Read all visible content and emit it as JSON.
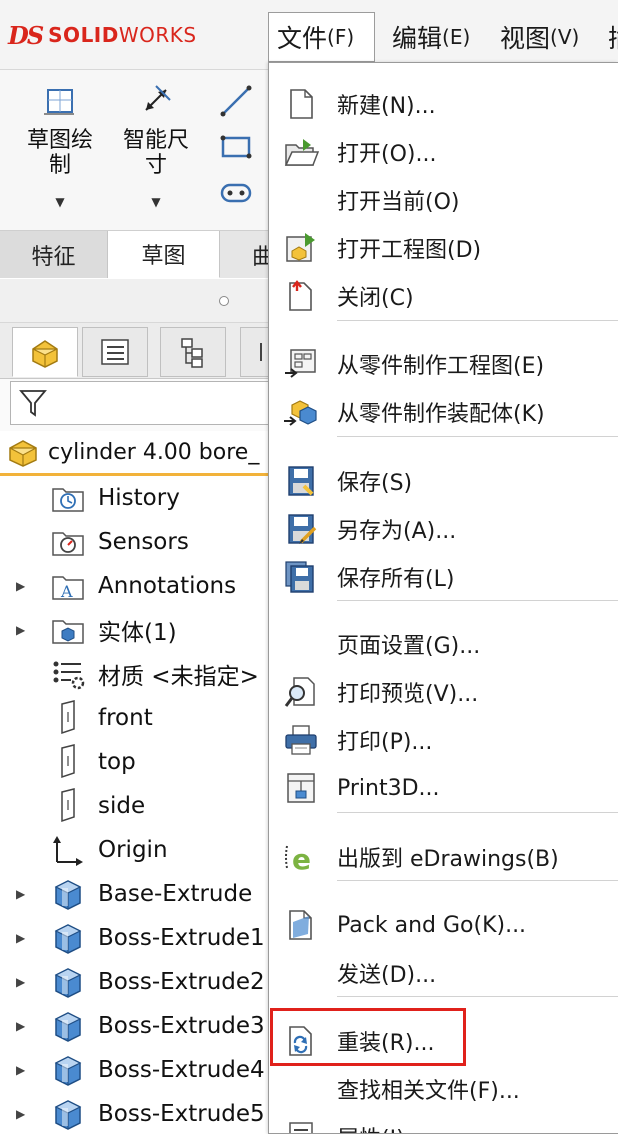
{
  "app": {
    "logo_mark": "DS",
    "logo_text_bold": "SOLID",
    "logo_text_light": "WORKS",
    "brand_color": "#d9261c"
  },
  "menubar": {
    "file": {
      "label": "文件",
      "accel": "(F)"
    },
    "edit": {
      "label": "编辑",
      "accel": "(E)"
    },
    "view": {
      "label": "视图",
      "accel": "(V)"
    },
    "more": {
      "label": "插"
    }
  },
  "command_manager": {
    "sketch": {
      "label_line1": "草图绘",
      "label_line2": "制",
      "icon": "sketch-icon"
    },
    "smart_dimension": {
      "label_line1": "智能尺",
      "label_line2": "寸",
      "icon": "smart-dimension-icon"
    },
    "tools": [
      "line-icon",
      "rectangle-icon",
      "slot-icon"
    ]
  },
  "tabs": {
    "feature": "特征",
    "sketch": "草图",
    "surface": "曲"
  },
  "feature_tree": {
    "root": "cylinder 4.00 bore_",
    "items": [
      {
        "label": "History",
        "icon": "history-folder-icon",
        "expandable": false
      },
      {
        "label": "Sensors",
        "icon": "sensors-folder-icon",
        "expandable": false
      },
      {
        "label": "Annotations",
        "icon": "annotations-folder-icon",
        "expandable": true
      },
      {
        "label": "实体(1)",
        "icon": "solid-bodies-folder-icon",
        "expandable": true
      },
      {
        "label": "材质 <未指定>",
        "icon": "material-icon",
        "expandable": false
      },
      {
        "label": "front",
        "icon": "plane-icon",
        "expandable": false
      },
      {
        "label": "top",
        "icon": "plane-icon",
        "expandable": false
      },
      {
        "label": "side",
        "icon": "plane-icon",
        "expandable": false
      },
      {
        "label": "Origin",
        "icon": "origin-icon",
        "expandable": false
      },
      {
        "label": "Base-Extrude",
        "icon": "extrude-icon",
        "expandable": true
      },
      {
        "label": "Boss-Extrude1",
        "icon": "extrude-icon",
        "expandable": true
      },
      {
        "label": "Boss-Extrude2",
        "icon": "extrude-icon",
        "expandable": true
      },
      {
        "label": "Boss-Extrude3",
        "icon": "extrude-icon",
        "expandable": true
      },
      {
        "label": "Boss-Extrude4",
        "icon": "extrude-icon",
        "expandable": true
      },
      {
        "label": "Boss-Extrude5",
        "icon": "extrude-icon",
        "expandable": true
      }
    ]
  },
  "file_menu": {
    "items": [
      {
        "label": "新建(N)...",
        "icon": "new-document-icon"
      },
      {
        "label": "打开(O)...",
        "icon": "open-folder-icon"
      },
      {
        "label": "打开当前(O)",
        "icon": ""
      },
      {
        "label": "打开工程图(D)",
        "icon": "open-drawing-icon"
      },
      {
        "label": "关闭(C)",
        "icon": "close-document-icon"
      },
      {
        "label": "从零件制作工程图(E)",
        "icon": "make-drawing-icon"
      },
      {
        "label": "从零件制作装配体(K)",
        "icon": "make-assembly-icon"
      },
      {
        "label": "保存(S)",
        "icon": "save-icon"
      },
      {
        "label": "另存为(A)...",
        "icon": "save-as-icon"
      },
      {
        "label": "保存所有(L)",
        "icon": "save-all-icon"
      },
      {
        "label": "页面设置(G)...",
        "icon": ""
      },
      {
        "label": "打印预览(V)...",
        "icon": "print-preview-icon"
      },
      {
        "label": "打印(P)...",
        "icon": "printer-icon"
      },
      {
        "label": "Print3D...",
        "icon": "print3d-icon"
      },
      {
        "label": "出版到 eDrawings(B)",
        "icon": "edrawings-icon"
      },
      {
        "label": "Pack and Go(K)...",
        "icon": "pack-and-go-icon"
      },
      {
        "label": "发送(D)...",
        "icon": ""
      },
      {
        "label": "重装(R)...",
        "icon": "reload-icon"
      },
      {
        "label": "查找相关文件(F)...",
        "icon": ""
      },
      {
        "label": "属性(I)...",
        "icon": "properties-icon"
      }
    ]
  },
  "highlight_color": "#e0211b"
}
